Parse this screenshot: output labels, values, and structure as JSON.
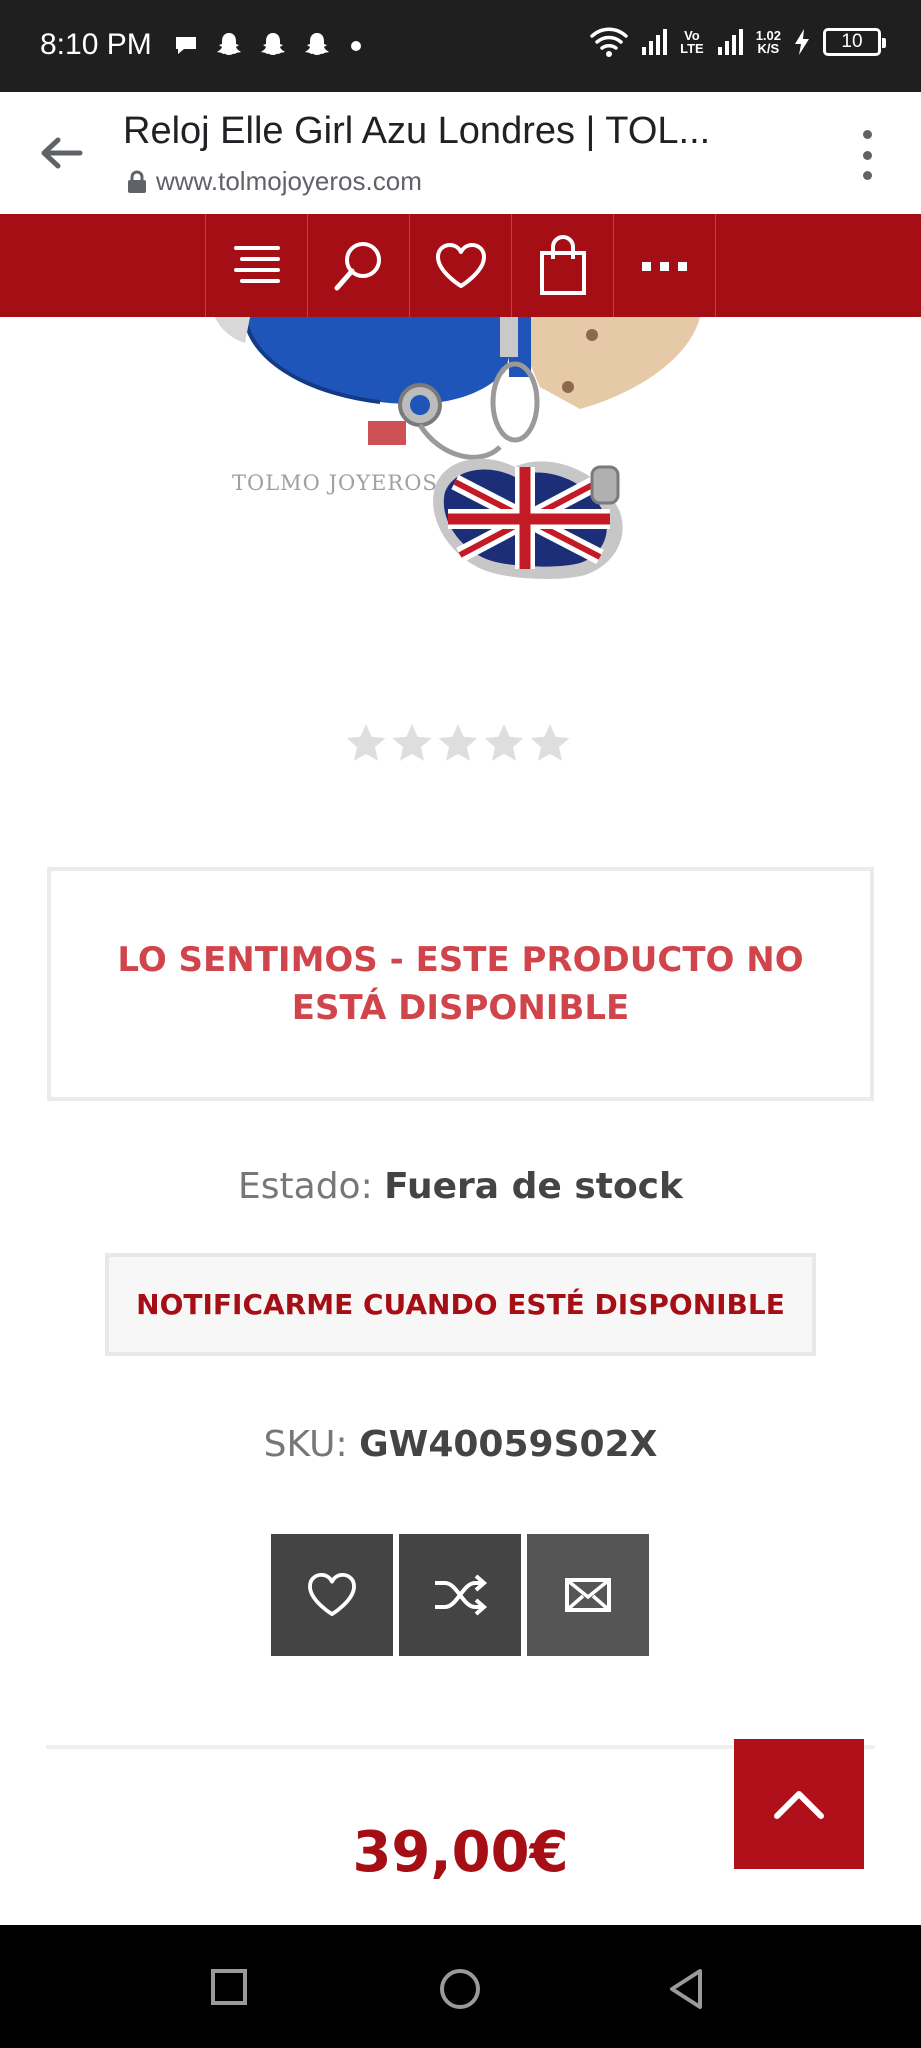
{
  "status_bar": {
    "time": "8:10 PM",
    "volte_top": "Vo",
    "volte_bottom": "LTE",
    "net_speed_top": "1.02",
    "net_speed_bottom": "K/S",
    "battery": "10"
  },
  "browser": {
    "title": "Reloj Elle Girl Azu Londres | TOL...",
    "url": "www.tolmojoyeros.com"
  },
  "product": {
    "image_watermark": "TOLMO JOYEROS",
    "rating_stars": 0,
    "rating_max": 5,
    "unavailable_message": "LO SENTIMOS - ESTE PRODUCTO NO ESTÁ DISPONIBLE",
    "status_label": "Estado:",
    "status_value": "Fuera de stock",
    "notify_label": "NOTIFICARME CUANDO ESTÉ DISPONIBLE",
    "sku_label": "SKU:",
    "sku_value": "GW40059S02X",
    "price": "39,00€"
  },
  "colors": {
    "brand_red": "#a60e15",
    "alert_red": "#d0454b",
    "dark_button": "#444444"
  }
}
